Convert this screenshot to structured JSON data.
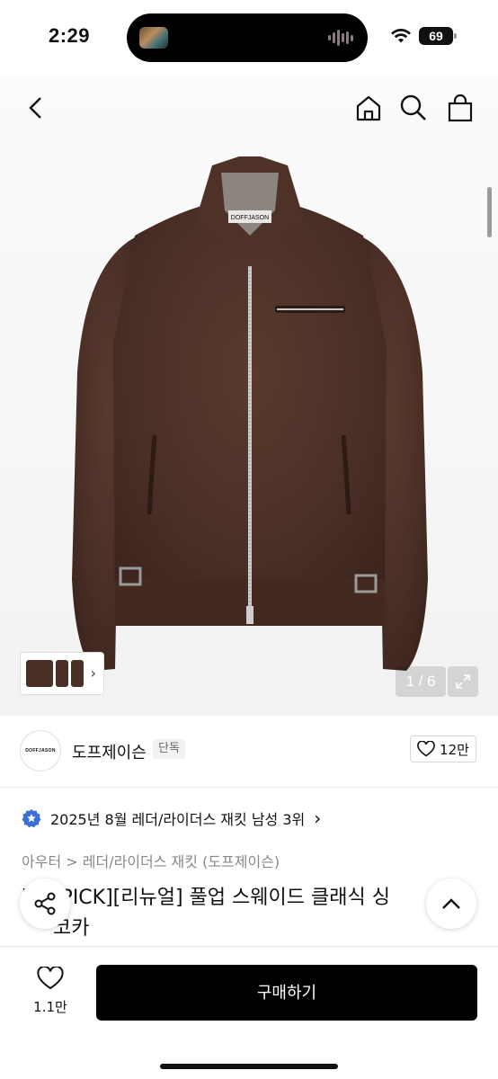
{
  "status_bar": {
    "time": "2:29",
    "battery": "69"
  },
  "header": {
    "back_icon": "chevron-left-icon",
    "home_icon": "home-icon",
    "search_icon": "search-icon",
    "cart_icon": "shopping-bag-icon"
  },
  "product_image": {
    "jacket_label": "DOFFJASON",
    "pager": "1 / 6"
  },
  "brand": {
    "logo_text": "DOFFJASON",
    "name": "도프제이슨",
    "badge": "단독",
    "likes": "12만"
  },
  "ranking": {
    "text": "2025년 8월 레더/라이더스 재킷 남성 3위",
    "chevron": "›"
  },
  "breadcrumb": {
    "parent": "아우터",
    "separator": ">",
    "child": "레더/라이더스 재킷 (도프제이슨)"
  },
  "product": {
    "title_line1": "[     PICK][리뉴얼] 풀업 스웨이드 클래식 싱",
    "title_line2": "     코카"
  },
  "bottom_bar": {
    "wish_count": "1.1만",
    "buy_label": "구매하기"
  },
  "colors": {
    "accent": "#000000",
    "rank_badge": "#3a6fd8",
    "jacket": "#4a2f26"
  }
}
